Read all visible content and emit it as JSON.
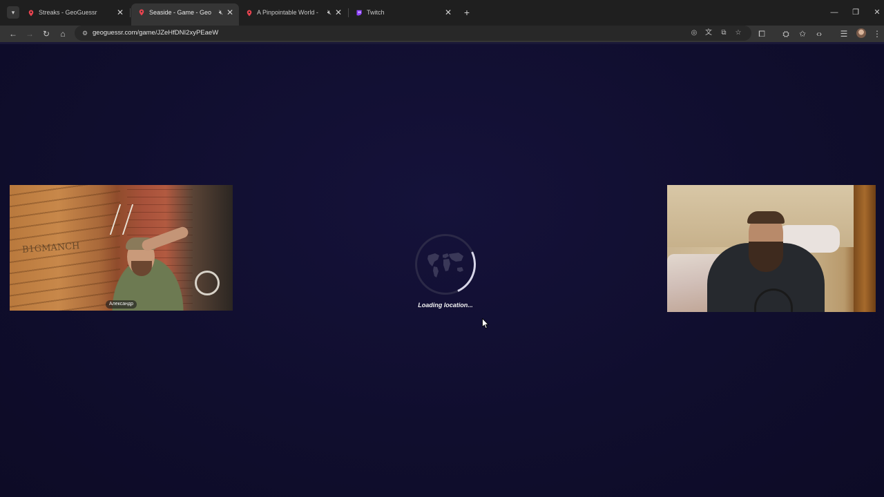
{
  "browser": {
    "tabs": [
      {
        "title": "Streaks - GeoGuessr",
        "favicon": "geoguessr-pin-icon",
        "muted": false,
        "active": false
      },
      {
        "title": "Seaside - Game - GeoGuessr",
        "favicon": "geoguessr-pin-icon",
        "muted": true,
        "active": true
      },
      {
        "title": "A Pinpointable World - Game",
        "favicon": "geoguessr-pin-icon",
        "muted": true,
        "active": false
      },
      {
        "title": "Twitch",
        "favicon": "twitch-icon",
        "muted": false,
        "active": false
      }
    ],
    "new_tab_label": "+",
    "url": "geoguessr.com/game/JZeHfDNI2xyPEaeW"
  },
  "page": {
    "loading_text": "Loading location...",
    "webcam_left": {
      "name_tag": "Александр",
      "wall_sign": "B1GMANCH"
    },
    "webcam_right": {}
  },
  "colors": {
    "page_background": "#100e2e",
    "spinner_track": "#2b2947",
    "spinner_arc": "#d7d5e8",
    "geoguessr_pin": "#e8434f",
    "twitch": "#9146ff"
  }
}
